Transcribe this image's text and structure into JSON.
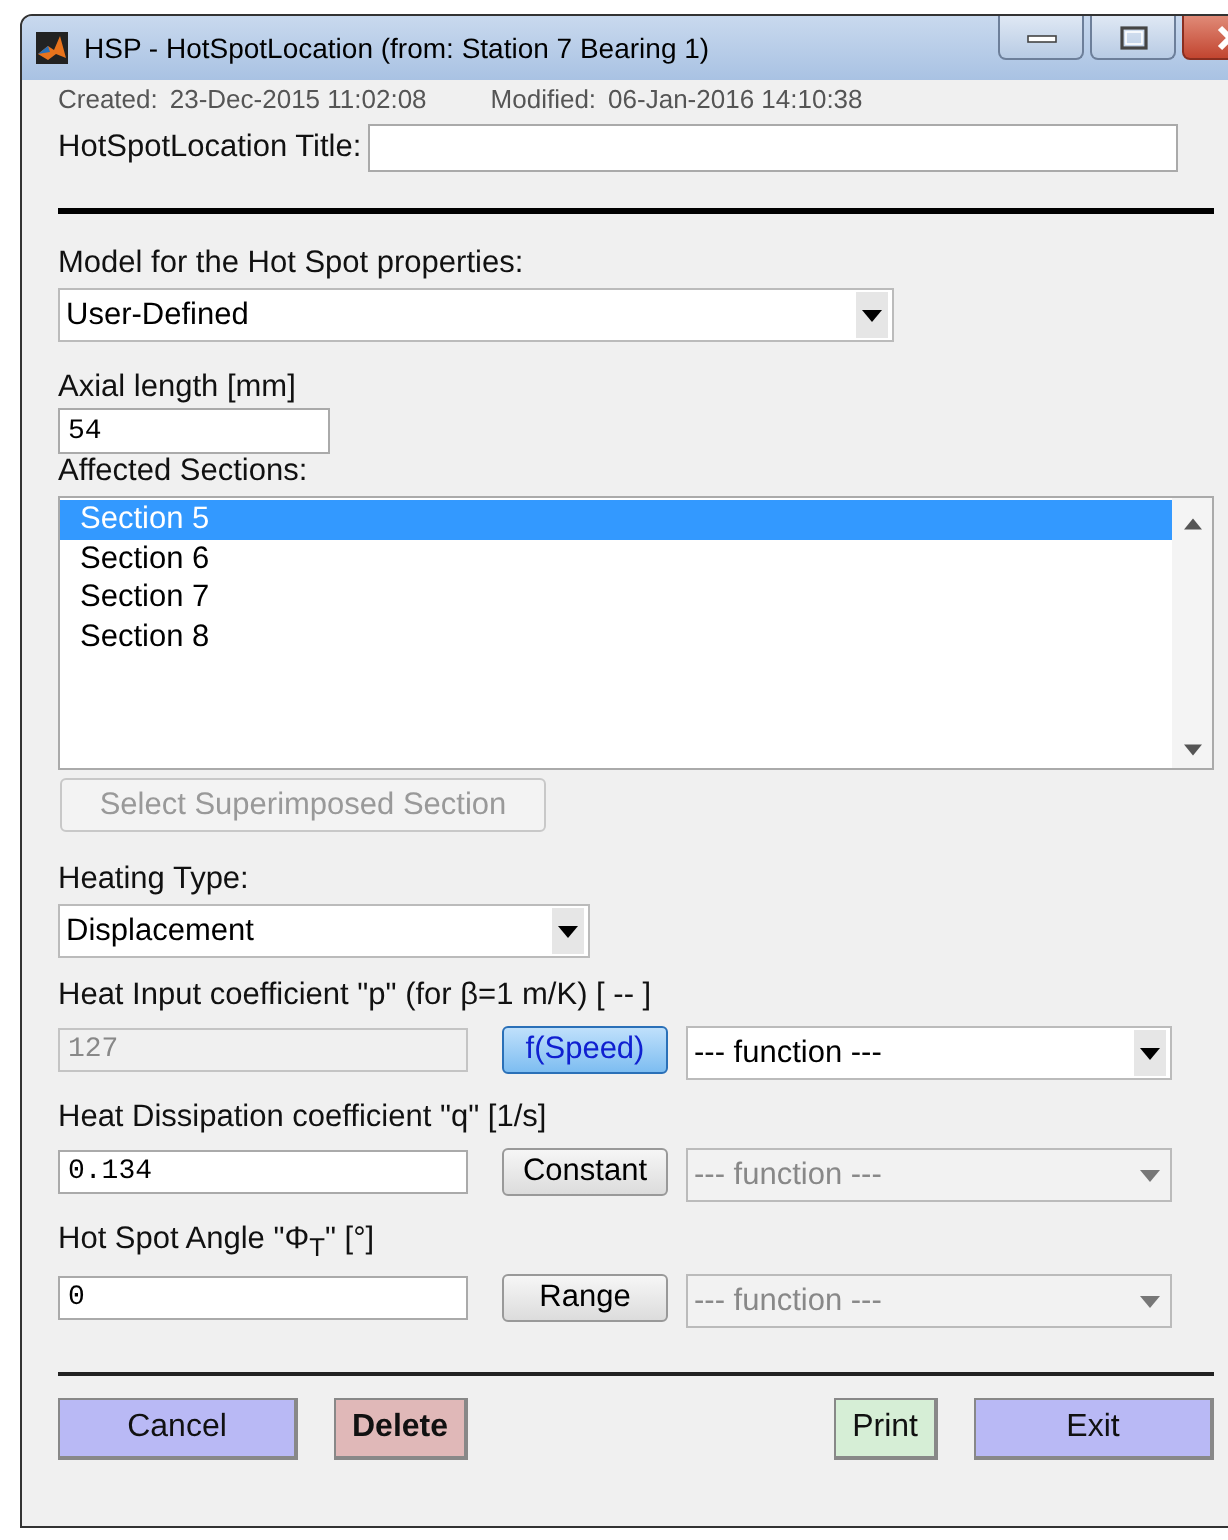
{
  "window": {
    "title": "HSP - HotSpotLocation (from: Station 7 Bearing 1)"
  },
  "info": {
    "created_label": "Created:",
    "created": "23-Dec-2015 11:02:08",
    "modified_label": "Modified:",
    "modified": "06-Jan-2016 14:10:38"
  },
  "title_field": {
    "label": "HotSpotLocation Title:"
  },
  "model": {
    "label": "Model for the Hot Spot properties:",
    "value": "User-Defined"
  },
  "axial_length": {
    "label": "Axial length [mm]",
    "value": "54"
  },
  "affected_sections": {
    "label": "Affected Sections:",
    "items": [
      {
        "label": "Section 5",
        "selected": true
      },
      {
        "label": "Section 6",
        "selected": false
      },
      {
        "label": "Section 7",
        "selected": false
      },
      {
        "label": "Section 8",
        "selected": false
      }
    ]
  },
  "superimposed_button": {
    "label": "Select Superimposed Section",
    "disabled": true
  },
  "heating_type": {
    "label": "Heating Type:",
    "value": "Displacement"
  },
  "coefficients": [
    {
      "label": "Heat Input coefficient \"p\" (for β=1 m/K) [ -- ]",
      "value": "127",
      "value_disabled": true,
      "mode": "f(Speed)",
      "mode_selected": true,
      "function": "--- function ---",
      "function_disabled": false
    },
    {
      "label": "Heat Dissipation coefficient \"q\" [1/s]",
      "value": "0.134",
      "value_disabled": false,
      "mode": "Constant",
      "mode_selected": false,
      "function": "--- function ---",
      "function_disabled": true
    },
    {
      "label": "Hot Spot Angle \"Φ$_{T}$\" [°]",
      "value": "0",
      "value_disabled": false,
      "mode": "Range",
      "mode_selected": false,
      "function": "--- function ---",
      "function_disabled": true
    }
  ],
  "left_buttons": [
    {
      "label": "Cancel",
      "color": "#b9b9f5",
      "bold": false
    },
    {
      "label": "Delete",
      "color": "#e0b8b8",
      "bold": true
    }
  ],
  "right_buttons": [
    {
      "label": "Print",
      "color": "#d6eed6",
      "bold": false
    },
    {
      "label": "Exit",
      "color": "#b9b9f5",
      "bold": false
    }
  ]
}
